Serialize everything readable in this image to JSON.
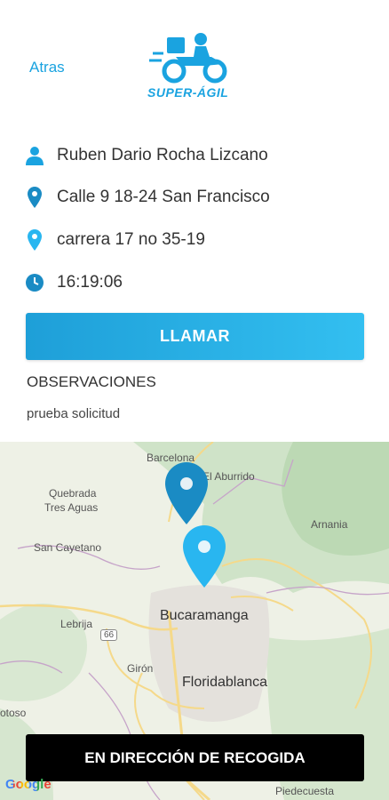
{
  "header": {
    "back_label": "Atras",
    "brand_name": "SUPER-ÁGIL"
  },
  "details": {
    "customer_name": "Ruben Dario Rocha Lizcano",
    "pickup_address": "Calle 9 18-24 San Francisco",
    "delivery_address": "carrera 17 no 35-19",
    "time": "16:19:06"
  },
  "actions": {
    "call_label": "LLAMAR",
    "pickup_label": "EN DIRECCIÓN DE RECOGIDA"
  },
  "observations": {
    "title": "OBSERVACIONES",
    "text": "prueba solicitud"
  },
  "map": {
    "labels": {
      "barcelona": "Barcelona",
      "el_aburrido": "El Aburrido",
      "quebrada": "Quebrada",
      "tres_aguas": "Tres Aguas",
      "arnania": "Arnania",
      "san_cayetano": "San Cayetano",
      "bucaramanga": "Bucaramanga",
      "lebrija": "Lebrija",
      "route_66": "66",
      "giron": "Girón",
      "floridablanca": "Floridablanca",
      "otoso": "otoso",
      "piedecuesta": "Piedecuesta"
    },
    "attribution": "Google"
  },
  "colors": {
    "accent": "#1aa3e0",
    "pin_dark": "#1a8bc4",
    "pin_light": "#29b6f0",
    "button_dark": "#000000"
  }
}
